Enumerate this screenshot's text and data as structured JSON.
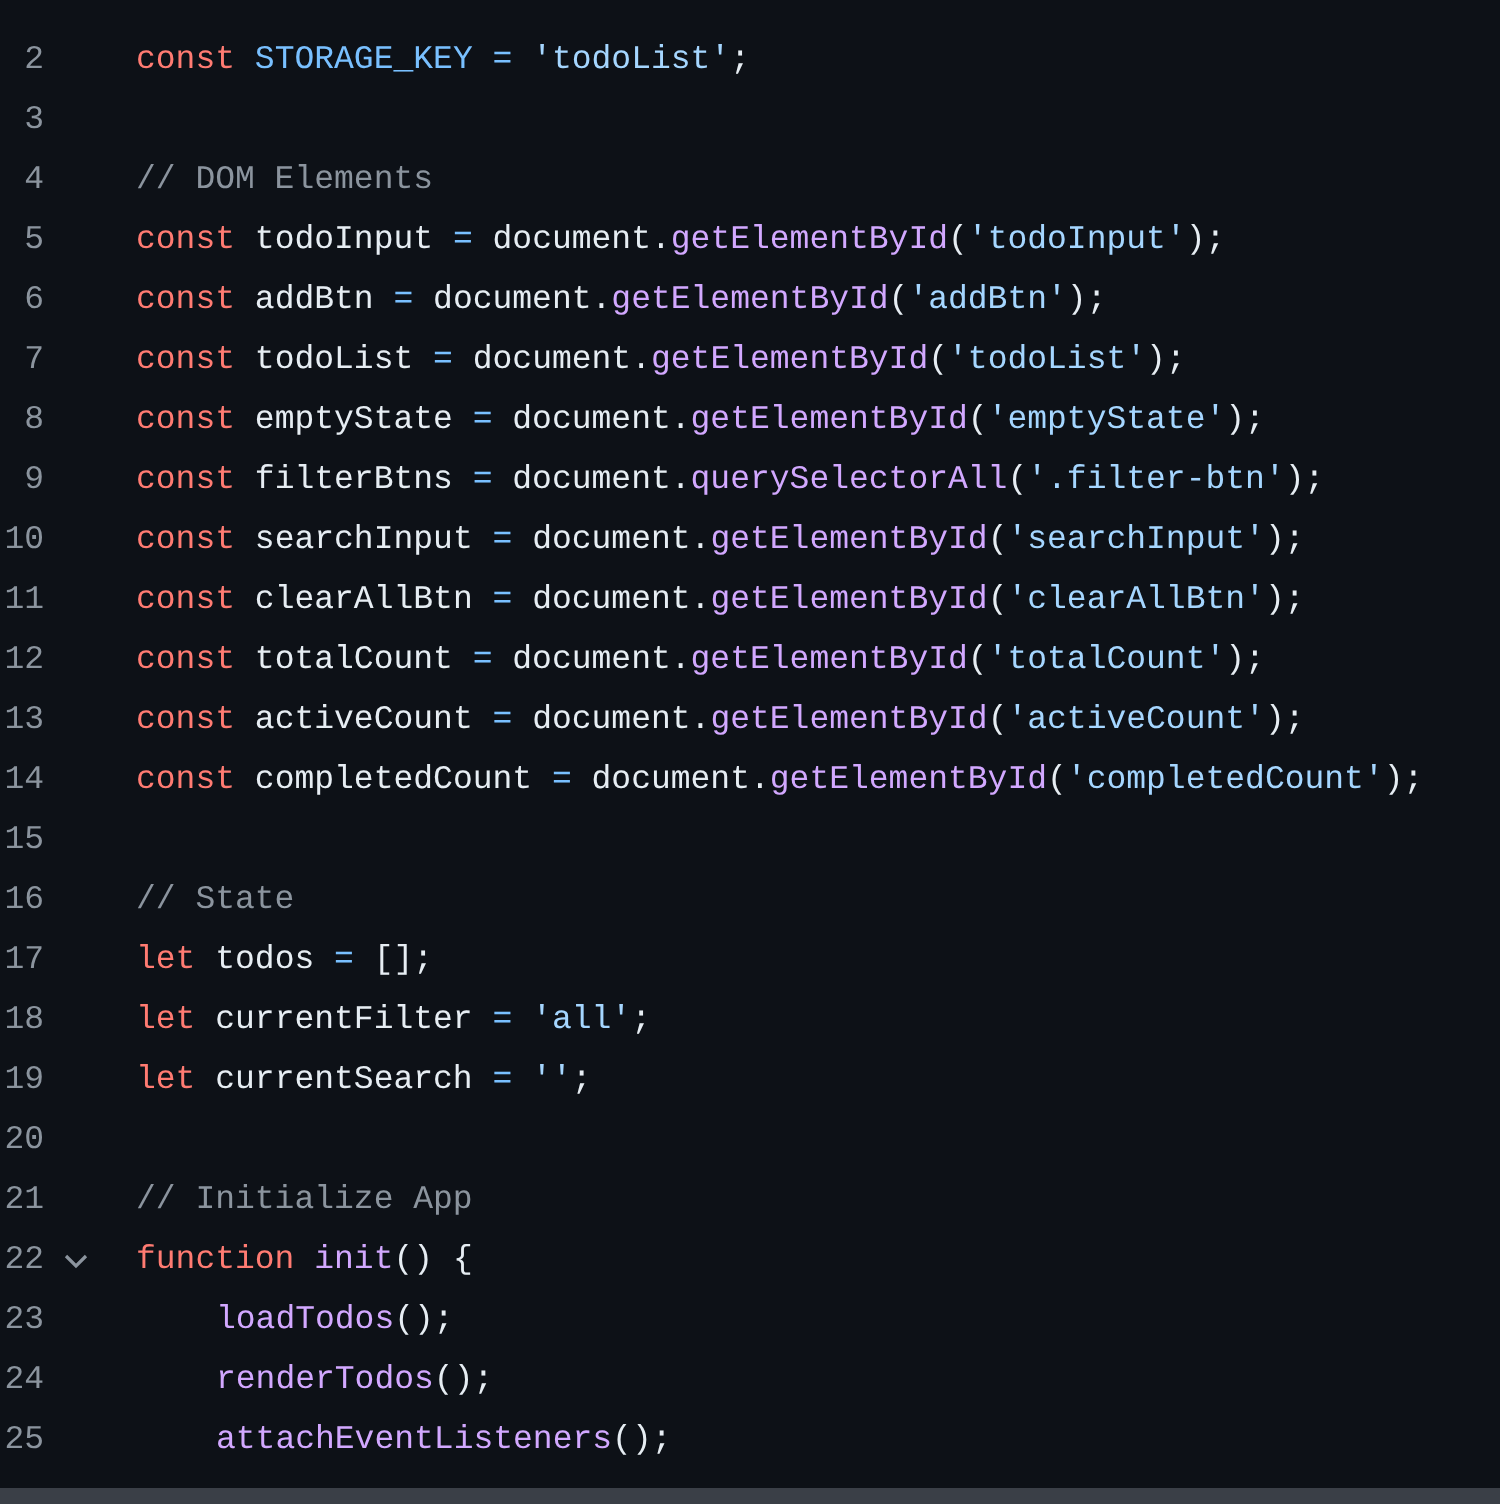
{
  "editor": {
    "lines": [
      {
        "number": "2",
        "tokens": [
          {
            "kind": "keyword",
            "text": "const "
          },
          {
            "kind": "constant",
            "text": "STORAGE_KEY "
          },
          {
            "kind": "constant",
            "text": "= "
          },
          {
            "kind": "string",
            "text": "'todoList'"
          },
          {
            "kind": "plain",
            "text": ";"
          }
        ]
      },
      {
        "number": "3"
      },
      {
        "number": "4",
        "tokens": [
          {
            "kind": "comment",
            "text": "// DOM Elements"
          }
        ]
      },
      {
        "number": "5",
        "tokens": [
          {
            "kind": "keyword",
            "text": "const "
          },
          {
            "kind": "plain",
            "text": "todoInput "
          },
          {
            "kind": "constant",
            "text": "= "
          },
          {
            "kind": "plain",
            "text": "document."
          },
          {
            "kind": "function",
            "text": "getElementById"
          },
          {
            "kind": "plain",
            "text": "("
          },
          {
            "kind": "string",
            "text": "'todoInput'"
          },
          {
            "kind": "plain",
            "text": ");"
          }
        ]
      },
      {
        "number": "6",
        "tokens": [
          {
            "kind": "keyword",
            "text": "const "
          },
          {
            "kind": "plain",
            "text": "addBtn "
          },
          {
            "kind": "constant",
            "text": "= "
          },
          {
            "kind": "plain",
            "text": "document."
          },
          {
            "kind": "function",
            "text": "getElementById"
          },
          {
            "kind": "plain",
            "text": "("
          },
          {
            "kind": "string",
            "text": "'addBtn'"
          },
          {
            "kind": "plain",
            "text": ");"
          }
        ]
      },
      {
        "number": "7",
        "tokens": [
          {
            "kind": "keyword",
            "text": "const "
          },
          {
            "kind": "plain",
            "text": "todoList "
          },
          {
            "kind": "constant",
            "text": "= "
          },
          {
            "kind": "plain",
            "text": "document."
          },
          {
            "kind": "function",
            "text": "getElementById"
          },
          {
            "kind": "plain",
            "text": "("
          },
          {
            "kind": "string",
            "text": "'todoList'"
          },
          {
            "kind": "plain",
            "text": ");"
          }
        ]
      },
      {
        "number": "8",
        "tokens": [
          {
            "kind": "keyword",
            "text": "const "
          },
          {
            "kind": "plain",
            "text": "emptyState "
          },
          {
            "kind": "constant",
            "text": "= "
          },
          {
            "kind": "plain",
            "text": "document."
          },
          {
            "kind": "function",
            "text": "getElementById"
          },
          {
            "kind": "plain",
            "text": "("
          },
          {
            "kind": "string",
            "text": "'emptyState'"
          },
          {
            "kind": "plain",
            "text": ");"
          }
        ]
      },
      {
        "number": "9",
        "tokens": [
          {
            "kind": "keyword",
            "text": "const "
          },
          {
            "kind": "plain",
            "text": "filterBtns "
          },
          {
            "kind": "constant",
            "text": "= "
          },
          {
            "kind": "plain",
            "text": "document."
          },
          {
            "kind": "function",
            "text": "querySelectorAll"
          },
          {
            "kind": "plain",
            "text": "("
          },
          {
            "kind": "string",
            "text": "'.filter-btn'"
          },
          {
            "kind": "plain",
            "text": ");"
          }
        ]
      },
      {
        "number": "10",
        "tokens": [
          {
            "kind": "keyword",
            "text": "const "
          },
          {
            "kind": "plain",
            "text": "searchInput "
          },
          {
            "kind": "constant",
            "text": "= "
          },
          {
            "kind": "plain",
            "text": "document."
          },
          {
            "kind": "function",
            "text": "getElementById"
          },
          {
            "kind": "plain",
            "text": "("
          },
          {
            "kind": "string",
            "text": "'searchInput'"
          },
          {
            "kind": "plain",
            "text": ");"
          }
        ]
      },
      {
        "number": "11",
        "tokens": [
          {
            "kind": "keyword",
            "text": "const "
          },
          {
            "kind": "plain",
            "text": "clearAllBtn "
          },
          {
            "kind": "constant",
            "text": "= "
          },
          {
            "kind": "plain",
            "text": "document."
          },
          {
            "kind": "function",
            "text": "getElementById"
          },
          {
            "kind": "plain",
            "text": "("
          },
          {
            "kind": "string",
            "text": "'clearAllBtn'"
          },
          {
            "kind": "plain",
            "text": ");"
          }
        ]
      },
      {
        "number": "12",
        "tokens": [
          {
            "kind": "keyword",
            "text": "const "
          },
          {
            "kind": "plain",
            "text": "totalCount "
          },
          {
            "kind": "constant",
            "text": "= "
          },
          {
            "kind": "plain",
            "text": "document."
          },
          {
            "kind": "function",
            "text": "getElementById"
          },
          {
            "kind": "plain",
            "text": "("
          },
          {
            "kind": "string",
            "text": "'totalCount'"
          },
          {
            "kind": "plain",
            "text": ");"
          }
        ]
      },
      {
        "number": "13",
        "tokens": [
          {
            "kind": "keyword",
            "text": "const "
          },
          {
            "kind": "plain",
            "text": "activeCount "
          },
          {
            "kind": "constant",
            "text": "= "
          },
          {
            "kind": "plain",
            "text": "document."
          },
          {
            "kind": "function",
            "text": "getElementById"
          },
          {
            "kind": "plain",
            "text": "("
          },
          {
            "kind": "string",
            "text": "'activeCount'"
          },
          {
            "kind": "plain",
            "text": ");"
          }
        ]
      },
      {
        "number": "14",
        "tokens": [
          {
            "kind": "keyword",
            "text": "const "
          },
          {
            "kind": "plain",
            "text": "completedCount "
          },
          {
            "kind": "constant",
            "text": "= "
          },
          {
            "kind": "plain",
            "text": "document."
          },
          {
            "kind": "function",
            "text": "getElementById"
          },
          {
            "kind": "plain",
            "text": "("
          },
          {
            "kind": "string",
            "text": "'completedCount'"
          },
          {
            "kind": "plain",
            "text": ");"
          }
        ]
      },
      {
        "number": "15"
      },
      {
        "number": "16",
        "tokens": [
          {
            "kind": "comment",
            "text": "// State"
          }
        ]
      },
      {
        "number": "17",
        "tokens": [
          {
            "kind": "keyword",
            "text": "let "
          },
          {
            "kind": "plain",
            "text": "todos "
          },
          {
            "kind": "constant",
            "text": "= "
          },
          {
            "kind": "plain",
            "text": "[];"
          }
        ]
      },
      {
        "number": "18",
        "tokens": [
          {
            "kind": "keyword",
            "text": "let "
          },
          {
            "kind": "plain",
            "text": "currentFilter "
          },
          {
            "kind": "constant",
            "text": "= "
          },
          {
            "kind": "string",
            "text": "'all'"
          },
          {
            "kind": "plain",
            "text": ";"
          }
        ]
      },
      {
        "number": "19",
        "tokens": [
          {
            "kind": "keyword",
            "text": "let "
          },
          {
            "kind": "plain",
            "text": "currentSearch "
          },
          {
            "kind": "constant",
            "text": "= "
          },
          {
            "kind": "string",
            "text": "''"
          },
          {
            "kind": "plain",
            "text": ";"
          }
        ]
      },
      {
        "number": "20"
      },
      {
        "number": "21",
        "tokens": [
          {
            "kind": "comment",
            "text": "// Initialize App"
          }
        ]
      },
      {
        "number": "22",
        "expanded": true,
        "tokens": [
          {
            "kind": "keyword",
            "text": "function "
          },
          {
            "kind": "function",
            "text": "init"
          },
          {
            "kind": "plain",
            "text": "() {"
          }
        ],
        "children": [
          {
            "number": "23",
            "tokens": [
              {
                "kind": "function",
                "text": "loadTodos"
              },
              {
                "kind": "plain",
                "text": "();"
              }
            ]
          },
          {
            "number": "24",
            "tokens": [
              {
                "kind": "function",
                "text": "renderTodos"
              },
              {
                "kind": "plain",
                "text": "();"
              }
            ]
          },
          {
            "number": "25",
            "tokens": [
              {
                "kind": "function",
                "text": "attachEventListeners"
              },
              {
                "kind": "plain",
                "text": "();"
              }
            ]
          }
        ]
      }
    ]
  }
}
